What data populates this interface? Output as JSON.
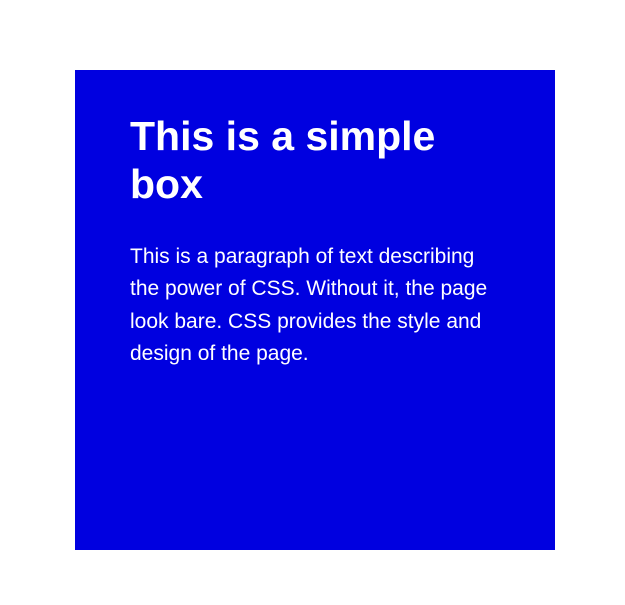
{
  "box": {
    "heading": "This is a simple box",
    "paragraph": "This is a paragraph of text describing the power of CSS. Without it, the page look bare. CSS provides the style and design of the page."
  }
}
